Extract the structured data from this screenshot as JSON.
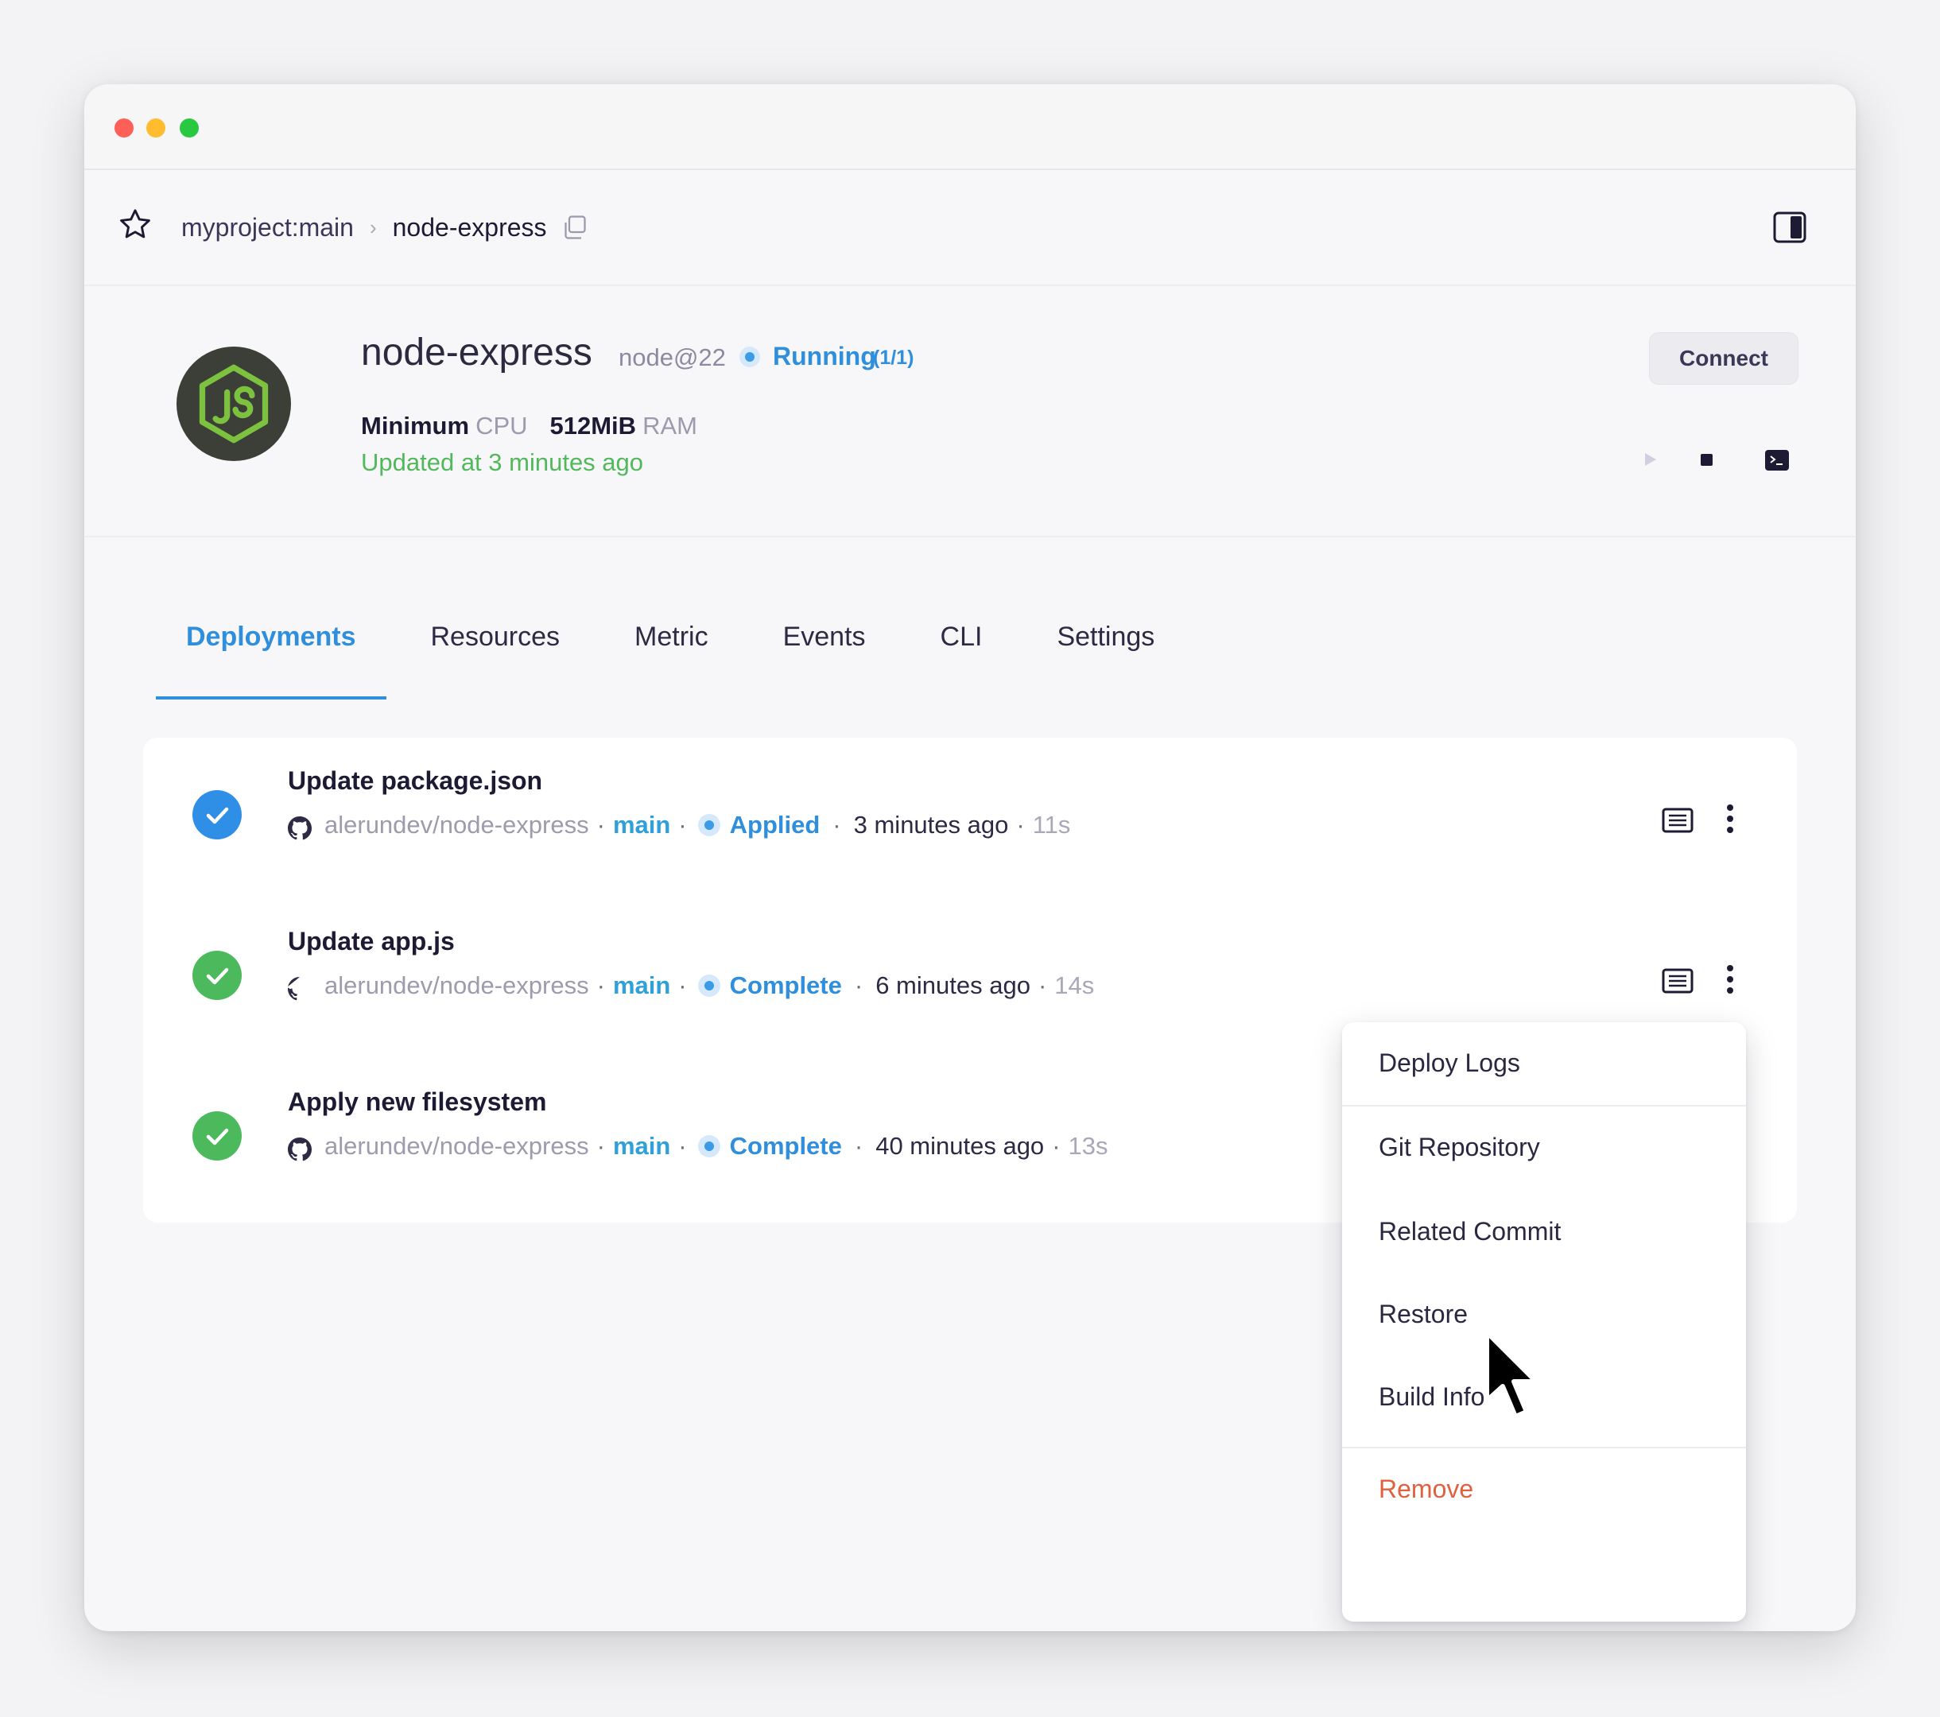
{
  "window": {
    "traffic_lights": [
      "close",
      "minimize",
      "maximize"
    ]
  },
  "breadcrumb": {
    "project": "myproject:main",
    "separator": "›",
    "service": "node-express"
  },
  "service": {
    "name": "node-express",
    "runtime": "node@22",
    "status": "Running",
    "replicas": "(1/1)",
    "cpu_value": "Minimum",
    "cpu_label": "CPU",
    "ram_value": "512MiB",
    "ram_label": "RAM",
    "updated": "Updated at 3 minutes ago",
    "connect_label": "Connect",
    "logo_icon": "nodejs-logo-icon",
    "colors": {
      "status": "#2f8fdc",
      "updated": "#52b85c",
      "logo_bg": "#3c3f38",
      "logo_green": "#7cc23e"
    }
  },
  "tabs": [
    {
      "label": "Deployments",
      "active": true
    },
    {
      "label": "Resources",
      "active": false
    },
    {
      "label": "Metric",
      "active": false
    },
    {
      "label": "Events",
      "active": false
    },
    {
      "label": "CLI",
      "active": false
    },
    {
      "label": "Settings",
      "active": false
    }
  ],
  "deployments": [
    {
      "title": "Update package.json",
      "repo": "alerundev/node-express",
      "branch": "main",
      "status": "Applied",
      "time": "3 minutes ago",
      "duration": "11s",
      "check_color": "#2f8fe6"
    },
    {
      "title": "Update app.js",
      "repo": "alerundev/node-express",
      "branch": "main",
      "status": "Complete",
      "time": "6 minutes ago",
      "duration": "14s",
      "check_color": "#4cba5c"
    },
    {
      "title": "Apply new filesystem",
      "repo": "alerundev/node-express",
      "branch": "main",
      "status": "Complete",
      "time": "40 minutes ago",
      "duration": "13s",
      "check_color": "#4cba5c"
    }
  ],
  "menu": {
    "items": [
      {
        "label": "Deploy Logs"
      },
      {
        "label": "Git Repository"
      },
      {
        "label": "Related Commit"
      },
      {
        "label": "Restore"
      },
      {
        "label": "Build Info"
      },
      {
        "label": "Remove",
        "danger": true
      }
    ],
    "danger_color": "#e0613f"
  },
  "separator_dot": "·"
}
